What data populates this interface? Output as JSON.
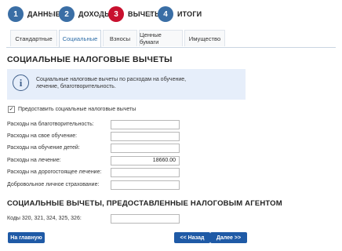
{
  "steps": [
    {
      "num": "1",
      "label": "ДАННЫЕ",
      "state": "done"
    },
    {
      "num": "2",
      "label": "ДОХОДЫ",
      "state": "done"
    },
    {
      "num": "3",
      "label": "ВЫЧЕТЫ",
      "state": "active"
    },
    {
      "num": "4",
      "label": "ИТОГИ",
      "state": "done"
    }
  ],
  "tabs": [
    "Стандартные",
    "Социальные",
    "Взносы",
    "Ценные бумаги",
    "Имущество"
  ],
  "active_tab": "Социальные",
  "section_title": "СОЦИАЛЬНЫЕ НАЛОГОВЫЕ ВЫЧЕТЫ",
  "info": {
    "icon": "info-icon",
    "text": "Социальные налоговые вычеты по расходам на обучение, лечение, благотворительность."
  },
  "checkbox": {
    "label": "Предоставить социальные налоговые вычеты",
    "checked": true,
    "mark": "✓"
  },
  "fields": [
    {
      "label": "Расходы на благотворительность:",
      "value": ""
    },
    {
      "label": "Расходы на свое обучение:",
      "value": ""
    },
    {
      "label": "Расходы на обучение детей:",
      "value": ""
    },
    {
      "label": "Расходы на лечение:",
      "value": "18660.00"
    },
    {
      "label": "Расходы на дорогостоящее лечение:",
      "value": ""
    },
    {
      "label": "Добровольное личное страхование:",
      "value": ""
    }
  ],
  "section2_title": "СОЦИАЛЬНЫЕ ВЫЧЕТЫ, ПРЕДОСТАВЛЕННЫЕ НАЛОГОВЫМ АГЕНТОМ",
  "agent_field": {
    "label": "Коды 320, 321, 324, 325, 326:",
    "value": ""
  },
  "buttons": {
    "home": "На главную",
    "back": "<< Назад",
    "next": "Далее >>"
  },
  "colors": {
    "accent": "#1f5aa6",
    "step_done": "#3a6ea5",
    "step_active": "#c8102e",
    "info_bg": "#e6eefa"
  }
}
